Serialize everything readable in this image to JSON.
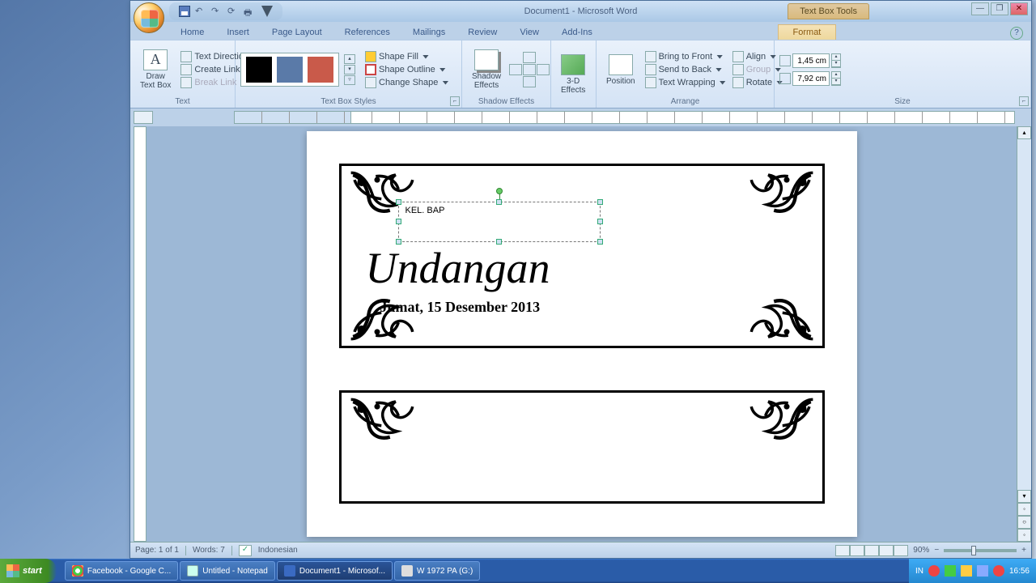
{
  "titlebar": {
    "title": "Document1 - Microsoft Word",
    "tools_title": "Text Box Tools"
  },
  "tabs": {
    "items": [
      "Home",
      "Insert",
      "Page Layout",
      "References",
      "Mailings",
      "Review",
      "View",
      "Add-Ins"
    ],
    "contextual": "Format"
  },
  "ribbon": {
    "text": {
      "group": "Text",
      "draw": "Draw\nText Box",
      "dir": "Text Direction",
      "createlink": "Create Link",
      "breaklink": "Break Link"
    },
    "styles": {
      "group": "Text Box Styles",
      "fill": "Shape Fill",
      "outline": "Shape Outline",
      "change": "Change Shape"
    },
    "shadow": {
      "group": "Shadow Effects",
      "btn": "Shadow\nEffects"
    },
    "threed": {
      "btn": "3-D\nEffects"
    },
    "arrange": {
      "group": "Arrange",
      "position": "Position",
      "front": "Bring to Front",
      "back": "Send to Back",
      "wrap": "Text Wrapping",
      "align": "Align",
      "group_cmd": "Group",
      "rotate": "Rotate"
    },
    "size": {
      "group": "Size",
      "height": "1,45 cm",
      "width": "7,92 cm"
    }
  },
  "document": {
    "textbox_text": "KEL. BAP",
    "title": "Undangan",
    "date": "Jumat, 15 Desember 2013"
  },
  "status": {
    "page": "Page: 1 of 1",
    "words": "Words: 7",
    "lang": "Indonesian",
    "zoom": "90%"
  },
  "taskbar": {
    "start": "start",
    "items": [
      "Facebook - Google C...",
      "Untitled - Notepad",
      "Document1 - Microsof...",
      "W 1972 PA (G:)"
    ],
    "lang_ind": "IN",
    "time": "16:56"
  }
}
